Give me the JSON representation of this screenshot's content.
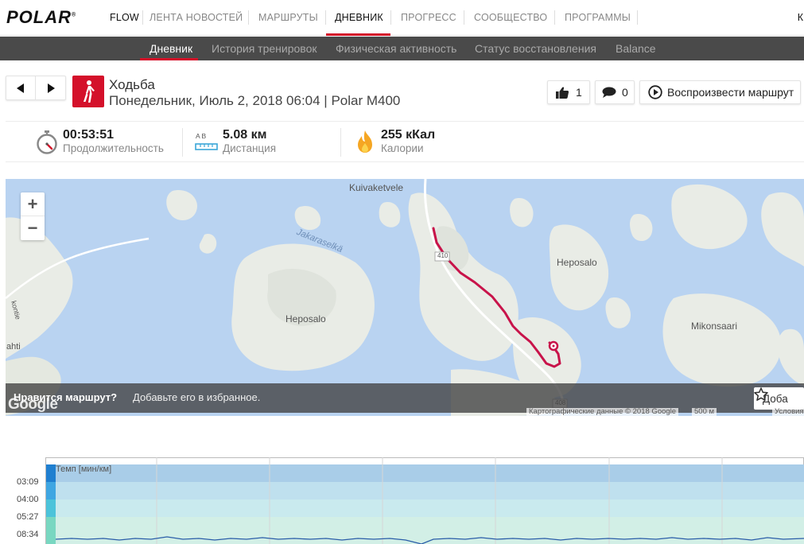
{
  "topnav": {
    "brand": "POLAR",
    "brand_mark": "®",
    "items": [
      "FLOW",
      "ЛЕНТА НОВОСТЕЙ",
      "МАРШРУТЫ",
      "ДНЕВНИК",
      "ПРОГРЕСС",
      "СООБЩЕСТВО",
      "ПРОГРАММЫ"
    ],
    "active_item": "ДНЕВНИК",
    "edge_text": "К"
  },
  "subnav": {
    "items": [
      "Дневник",
      "История тренировок",
      "Физическая активность",
      "Статус восстановления",
      "Balance"
    ],
    "active_item": "Дневник"
  },
  "activity": {
    "sport": "Ходьба",
    "subtitle": "Понедельник, Июль 2, 2018 06:04 | Polar M400",
    "sport_icon": "walking-person-icon",
    "likes": "1",
    "comments": "0",
    "replay_label": "Воспроизвести маршрут"
  },
  "stats": {
    "duration_value": "00:53:51",
    "duration_label": "Продолжительность",
    "distance_value": "5.08 км",
    "distance_label": "Дистанция",
    "distance_icon_text": "A B",
    "calories_value": "255 кКал",
    "calories_label": "Калории"
  },
  "map": {
    "zoom_in": "+",
    "zoom_out": "−",
    "labels": {
      "kuivaketvele": "Kuivaketvele",
      "jakaraselka": "Jakaraselkä",
      "heposalo_left": "Heposalo",
      "heposalo_right": "Heposalo",
      "mikonsaari": "Mikonsaari",
      "road_410": "410",
      "road_408": "408",
      "kontie": "kontie",
      "ahti": "ahti"
    },
    "favorite_question": "Нравится маршрут?",
    "favorite_text": "Добавьте его в избранное.",
    "favorite_button": "Доба",
    "attribution": "Картографические данные © 2018 Google",
    "scale": "500 м",
    "terms": "Условия",
    "google_logo": "Google",
    "route_color": "#c8134a"
  },
  "chart": {
    "series_label": "Темп [мин/км]",
    "y_ticks": [
      "03:09",
      "04:00",
      "05:27",
      "08:34"
    ]
  },
  "colors": {
    "accent": "#d4102a",
    "subnav_bg": "#4a4a4a"
  }
}
